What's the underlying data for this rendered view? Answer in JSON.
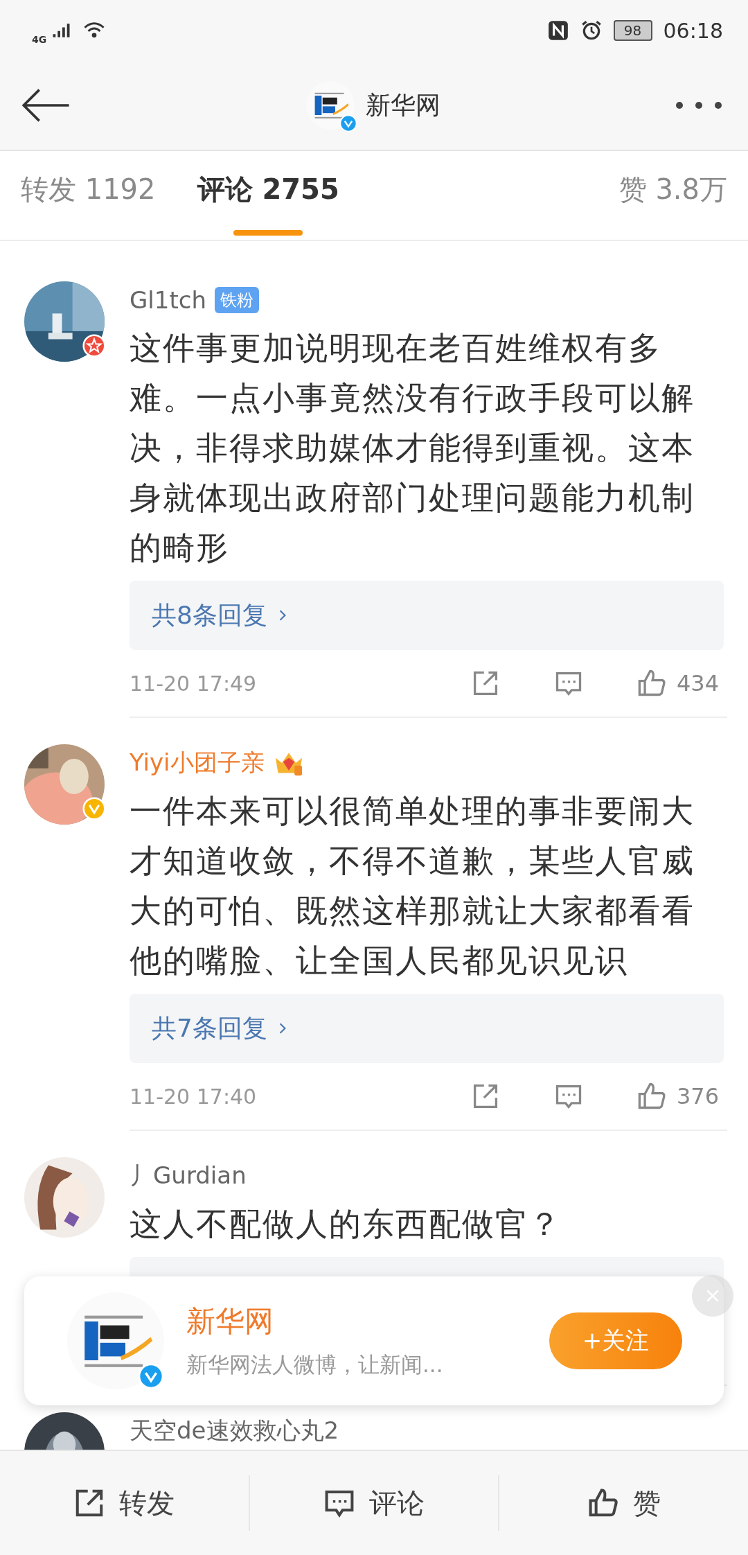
{
  "status_bar": {
    "network": "4G",
    "battery": "98",
    "time": "06:18"
  },
  "header": {
    "title": "新华网",
    "verified": true
  },
  "tabs": [
    {
      "label": "转发 1192",
      "selected": false
    },
    {
      "label": "评论 2755",
      "selected": true
    },
    {
      "label": "赞 3.8万",
      "selected": false
    }
  ],
  "comments": [
    {
      "kind": "fan",
      "user": "Gl1tch",
      "fan_badge": "铁粉",
      "text": "这件事更加说明现在老百姓维权有多难。一点小事竟然没有行政手段可以解决，非得求助媒体才能得到重视。这本身就体现出政府部门处理问题能力机制的畸形",
      "has_replies": true,
      "replies": "共8条回复",
      "time": "11-20 17:49",
      "likes": "434"
    },
    {
      "kind": "vip",
      "user": "Yiyi小团子亲",
      "text": "一件本来可以很简单处理的事非要闹大才知道收敛，不得不道歉，某些人官威大的可怕、既然这样那就让大家都看看他的嘴脸、让全国人民都见识见识",
      "has_replies": true,
      "replies": "共7条回复",
      "time": "11-20 17:40",
      "likes": "376"
    },
    {
      "kind": "plain",
      "user": "丿Gurdian",
      "text": "这人不配做人的东西配做官？",
      "has_replies": true
    },
    {
      "kind": "plain",
      "user": "天空de速效救心丸2"
    }
  ],
  "follow_card": {
    "name": "新华网",
    "description": "新华网法人微博，让新闻...",
    "button": "+关注",
    "verified": true
  },
  "bottom_bar": [
    {
      "kind": "share",
      "label": "转发"
    },
    {
      "kind": "comment",
      "label": "评论"
    },
    {
      "kind": "like",
      "label": "赞"
    }
  ]
}
